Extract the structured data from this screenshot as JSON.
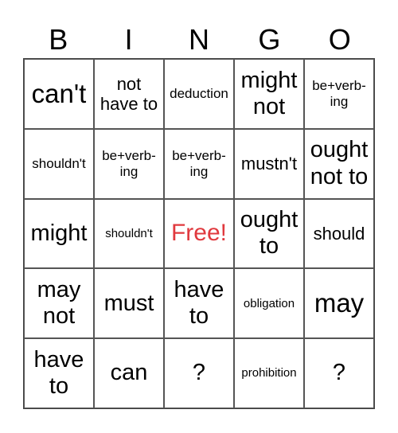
{
  "header": {
    "letters": [
      "B",
      "I",
      "N",
      "G",
      "O"
    ]
  },
  "board": {
    "free_color": "#e0393e",
    "rows": [
      [
        {
          "text": "can't",
          "size": "xl"
        },
        {
          "text": "not\nhave to",
          "size": "m"
        },
        {
          "text": "deduction",
          "size": "s"
        },
        {
          "text": "might\nnot",
          "size": "l"
        },
        {
          "text": "be+verb-\ning",
          "size": "s"
        }
      ],
      [
        {
          "text": "shouldn't",
          "size": "s"
        },
        {
          "text": "be+verb-\ning",
          "size": "s"
        },
        {
          "text": "be+verb-\ning",
          "size": "s"
        },
        {
          "text": "mustn't",
          "size": "m"
        },
        {
          "text": "ought\nnot to",
          "size": "l"
        }
      ],
      [
        {
          "text": "might",
          "size": "l"
        },
        {
          "text": "shouldn't",
          "size": "xs"
        },
        {
          "text": "Free!",
          "size": "free"
        },
        {
          "text": "ought\nto",
          "size": "l"
        },
        {
          "text": "should",
          "size": "m"
        }
      ],
      [
        {
          "text": "may\nnot",
          "size": "l"
        },
        {
          "text": "must",
          "size": "l"
        },
        {
          "text": "have\nto",
          "size": "l"
        },
        {
          "text": "obligation",
          "size": "xs"
        },
        {
          "text": "may",
          "size": "xl"
        }
      ],
      [
        {
          "text": "have\nto",
          "size": "l"
        },
        {
          "text": "can",
          "size": "l"
        },
        {
          "text": "?",
          "size": "l"
        },
        {
          "text": "prohibition",
          "size": "xs"
        },
        {
          "text": "?",
          "size": "l"
        }
      ]
    ]
  }
}
